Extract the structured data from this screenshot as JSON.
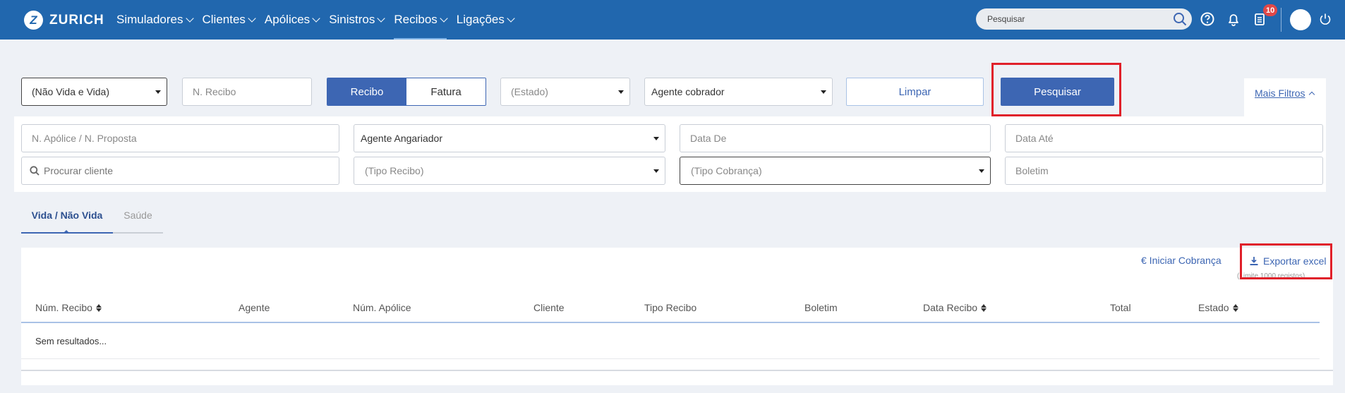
{
  "brand": {
    "name": "ZURICH",
    "logo_letter": "Z"
  },
  "nav": {
    "items": [
      {
        "label": "Simuladores"
      },
      {
        "label": "Clientes"
      },
      {
        "label": "Apólices"
      },
      {
        "label": "Sinistros"
      },
      {
        "label": "Recibos",
        "active": true
      },
      {
        "label": "Ligações"
      }
    ]
  },
  "header": {
    "search_placeholder": "Pesquisar",
    "notifications_count": "10"
  },
  "filters": {
    "tipo_ramo": "(Não Vida e Vida)",
    "n_recibo_placeholder": "N. Recibo",
    "toggle": {
      "recibo": "Recibo",
      "fatura": "Fatura"
    },
    "estado": "(Estado)",
    "agente_cobrador": "Agente cobrador",
    "limpar": "Limpar",
    "pesquisar": "Pesquisar",
    "mais_filtros": "Mais Filtros"
  },
  "advanced": {
    "n_apolice_placeholder": "N. Apólice / N. Proposta",
    "agente_angariador": "Agente Angariador",
    "data_de_placeholder": "Data De",
    "data_ate_placeholder": "Data Até",
    "procurar_cliente_placeholder": "Procurar cliente",
    "tipo_recibo": "(Tipo Recibo)",
    "tipo_cobranca": "(Tipo Cobrança)",
    "boletim_placeholder": "Boletim"
  },
  "tabs": {
    "vida": "Vida / Não Vida",
    "saude": "Saúde"
  },
  "actions": {
    "iniciar_cobranca": "€ Iniciar Cobrança",
    "exportar_excel": "Exportar excel",
    "limit_note": "(Limite 1000 registos)"
  },
  "table": {
    "columns": [
      "Núm. Recibo",
      "Agente",
      "Núm. Apólice",
      "Cliente",
      "Tipo Recibo",
      "Boletim",
      "Data Recibo",
      "Total",
      "Estado"
    ],
    "empty": "Sem resultados..."
  }
}
